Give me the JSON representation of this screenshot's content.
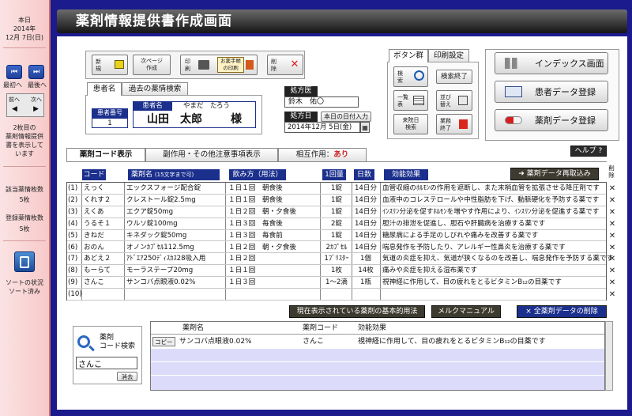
{
  "sidebar": {
    "date_label": "本日",
    "year": "2014年",
    "date": "12月 7日(日)",
    "nav_first": "最初へ",
    "nav_last": "最後へ",
    "nav_prev": "前へ",
    "nav_next": "次へ",
    "status_lines": [
      "2枚目の",
      "薬剤情報提供",
      "書を表示して",
      "います"
    ],
    "count_label": "該当薬情枚数",
    "count_value": "5枚",
    "registered_label": "登録薬情枚数",
    "registered_value": "5枚",
    "sort_label": "ソートの状況",
    "sort_value": "ソート済み"
  },
  "header": {
    "title": "薬剤情報提供書作成画面"
  },
  "toolbar": {
    "new_label": "新\n規",
    "next_page_label": "次ページ\n作成",
    "print_label": "印\n刷",
    "notebook_print_label": "お薬手帳\nの印刷",
    "delete_label": "削\n除"
  },
  "patient": {
    "tab_patient": "患者名",
    "tab_history": "過去の薬情検索",
    "id_label": "患者番号",
    "id_value": "1",
    "name_label": "患者名",
    "kana": "やまだ　たろう",
    "name": "山田　太郎",
    "honorific": "様"
  },
  "doctor": {
    "label": "処方医",
    "value": "鈴木　佑〇"
  },
  "prescription_date": {
    "label": "処方日",
    "today_button": "本日の日付入力",
    "value": "2014年12月 5日(金)"
  },
  "button_group": {
    "tab_buttons": "ボタン群",
    "tab_print": "印刷設定",
    "search": "検\n索",
    "search_end": "検索終了",
    "list": "一覧\n表",
    "sort": "並び\n替え",
    "visit_search": "来院日\n検索",
    "task_end": "業務\n終了"
  },
  "main_buttons": {
    "index": "インデックス画面",
    "patient_register": "患者データ登録",
    "drug_register": "薬剤データ登録"
  },
  "tabs": {
    "drug_code": "薬剤コード表示",
    "side_effects": "副作用・その他注意事項表示",
    "interaction_label": "相互作用：",
    "interaction_value": "あり",
    "help": "ヘルプ ?"
  },
  "grid": {
    "headers": {
      "code": "コード",
      "name": "薬剤名",
      "name_note": "(15文字まで可)",
      "usage": "飲み方（用法）",
      "dose": "1回量",
      "days": "日数",
      "effect": "効能効果",
      "reload": "薬剤データ再取込み",
      "delete": "削除"
    },
    "rows": [
      {
        "no": "(1)",
        "code": "えっく",
        "name": "エックスフォージ配合錠",
        "usage": "１日１回　朝食後",
        "dose": "1錠",
        "days": "14日分",
        "effect": "血管収縮のﾎﾙﾓﾝの作用を遮断し、また末梢血管を拡張させる降圧剤です"
      },
      {
        "no": "(2)",
        "code": "くれす２",
        "name": "クレストール錠2.5mg",
        "usage": "１日１回　朝食後",
        "dose": "1錠",
        "days": "14日分",
        "effect": "血液中のコレステロールや中性脂肪を下げ、動脈硬化を予防する薬です"
      },
      {
        "no": "(3)",
        "code": "えくあ",
        "name": "エクア錠50mg",
        "usage": "１日２回　朝・夕食後",
        "dose": "1錠",
        "days": "14日分",
        "effect": "ｲﾝｽﾘﾝ分泌を促すﾎﾙﾓﾝを増やす作用により、ｲﾝｽﾘﾝ分泌を促進する薬です"
      },
      {
        "no": "(4)",
        "code": "うるそ１",
        "name": "ウルソ錠100mg",
        "usage": "１日３回　毎食後",
        "dose": "2錠",
        "days": "14日分",
        "effect": "胆汁の排泄を促進し、胆石や肝臓病を治療する薬です"
      },
      {
        "no": "(5)",
        "code": "きねだ",
        "name": "キネダック錠50mg",
        "usage": "１日３回　毎食前",
        "dose": "1錠",
        "days": "14日分",
        "effect": "糖尿病による手足のしびれや痛みを改善する薬です"
      },
      {
        "no": "(6)",
        "code": "おのん",
        "name": "オノンｶﾌﾟｾﾙ112.5mg",
        "usage": "１日２回　朝・夕食後",
        "dose": "2ｶﾌﾟｾﾙ",
        "days": "14日分",
        "effect": "喘息発作を予防したり、アレルギー性鼻炎を治療する薬です"
      },
      {
        "no": "(7)",
        "code": "あどえ２",
        "name": "ｱﾄﾞｴｱ250ﾃﾞｨｽｶｽ28吸入用",
        "usage": "１日２回",
        "dose": "1ﾌﾞﾘｽﾀｰ",
        "days": "1個",
        "effect": "気道の炎症を抑え、気道が狭くなるのを改善し、喘息発作を予防する薬です"
      },
      {
        "no": "(8)",
        "code": "もーらて",
        "name": "モーラステープ20mg",
        "usage": "１日１回",
        "dose": "1枚",
        "days": "14枚",
        "effect": "痛みや炎症を抑える湿布薬です"
      },
      {
        "no": "(9)",
        "code": "さんこ",
        "name": "サンコバ点眼液0.02%",
        "usage": "１日３回",
        "dose": "1～2滴",
        "days": "1瓶",
        "effect": "視神経に作用して、目の疲れをとるビタミンB₁₂の目薬です"
      },
      {
        "no": "(10)",
        "code": "",
        "name": "",
        "usage": "",
        "dose": "",
        "days": "",
        "effect": ""
      }
    ]
  },
  "actions": {
    "basic_usage": "現在表示されている薬剤の基本的用法",
    "manual": "メルクマニュアル",
    "delete_all": "× 全薬剤データの削除"
  },
  "code_search": {
    "title_line1": "薬剤",
    "title_line2": "コード検索",
    "input_value": "さんこ",
    "clear": "消去"
  },
  "results": {
    "headers": {
      "name": "薬剤名",
      "code": "薬剤コード",
      "effect": "効能効果"
    },
    "copy": "コピー",
    "rows": [
      {
        "name": "サンコバ点眼液0.02%",
        "code": "さんこ",
        "effect": "視神経に作用して、目の疲れをとるビタミンB₁₂の目薬です"
      }
    ]
  }
}
